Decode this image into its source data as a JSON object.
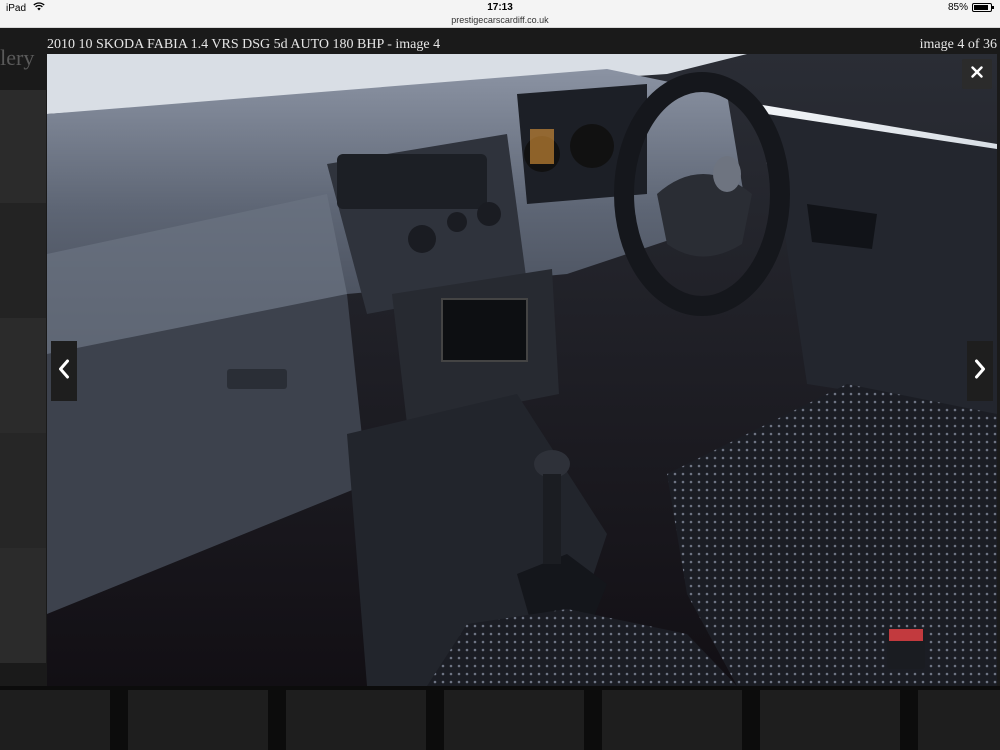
{
  "status_bar": {
    "device": "iPad",
    "time": "17:13",
    "url": "prestigecarscardiff.co.uk",
    "battery_text": "85%",
    "battery_level": 0.85
  },
  "background_page": {
    "gallery_title": "llery"
  },
  "lightbox": {
    "caption": "2010 10 SKODA FABIA 1.4 VRS DSG 5d AUTO 180 BHP - image 4",
    "counter": "image 4 of 36",
    "image_alt": "Car interior photo"
  },
  "colors": {
    "overlay": "#111111",
    "caption_text": "#e6e6e6",
    "button_bg": "#2b2b2b"
  },
  "icons": {
    "close": "close-icon",
    "prev": "chevron-left-icon",
    "next": "chevron-right-icon",
    "wifi": "wifi-icon",
    "battery": "battery-icon"
  }
}
